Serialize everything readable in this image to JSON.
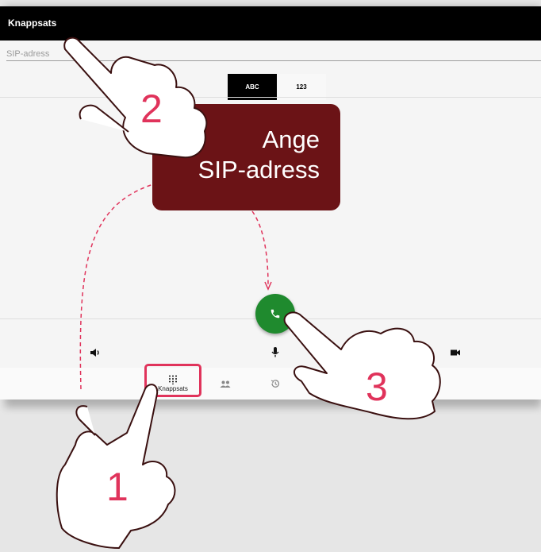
{
  "window": {
    "title": "Knappsats"
  },
  "dialer": {
    "sip_placeholder": "SIP-adress",
    "toggle": [
      {
        "label": "ABC",
        "active": true
      },
      {
        "label": "123",
        "active": false
      }
    ]
  },
  "controls": {
    "speaker_icon": "speaker-icon",
    "mic_icon": "microphone-icon",
    "video_icon": "video-camera-icon",
    "call_icon": "phone-icon",
    "call_color": "#1f8a2e"
  },
  "bottom_nav": [
    {
      "label": "Knappsats",
      "icon": "keypad-icon",
      "selected": true
    },
    {
      "label": "",
      "icon": "contacts-icon"
    },
    {
      "label": "",
      "icon": "history-icon"
    }
  ],
  "tutorial": {
    "callout_line1": "Ange",
    "callout_line2": "SIP-adress",
    "step1": "1",
    "step2": "2",
    "step3": "3",
    "accent_color": "#e0335b",
    "callout_color": "#6b1316"
  }
}
